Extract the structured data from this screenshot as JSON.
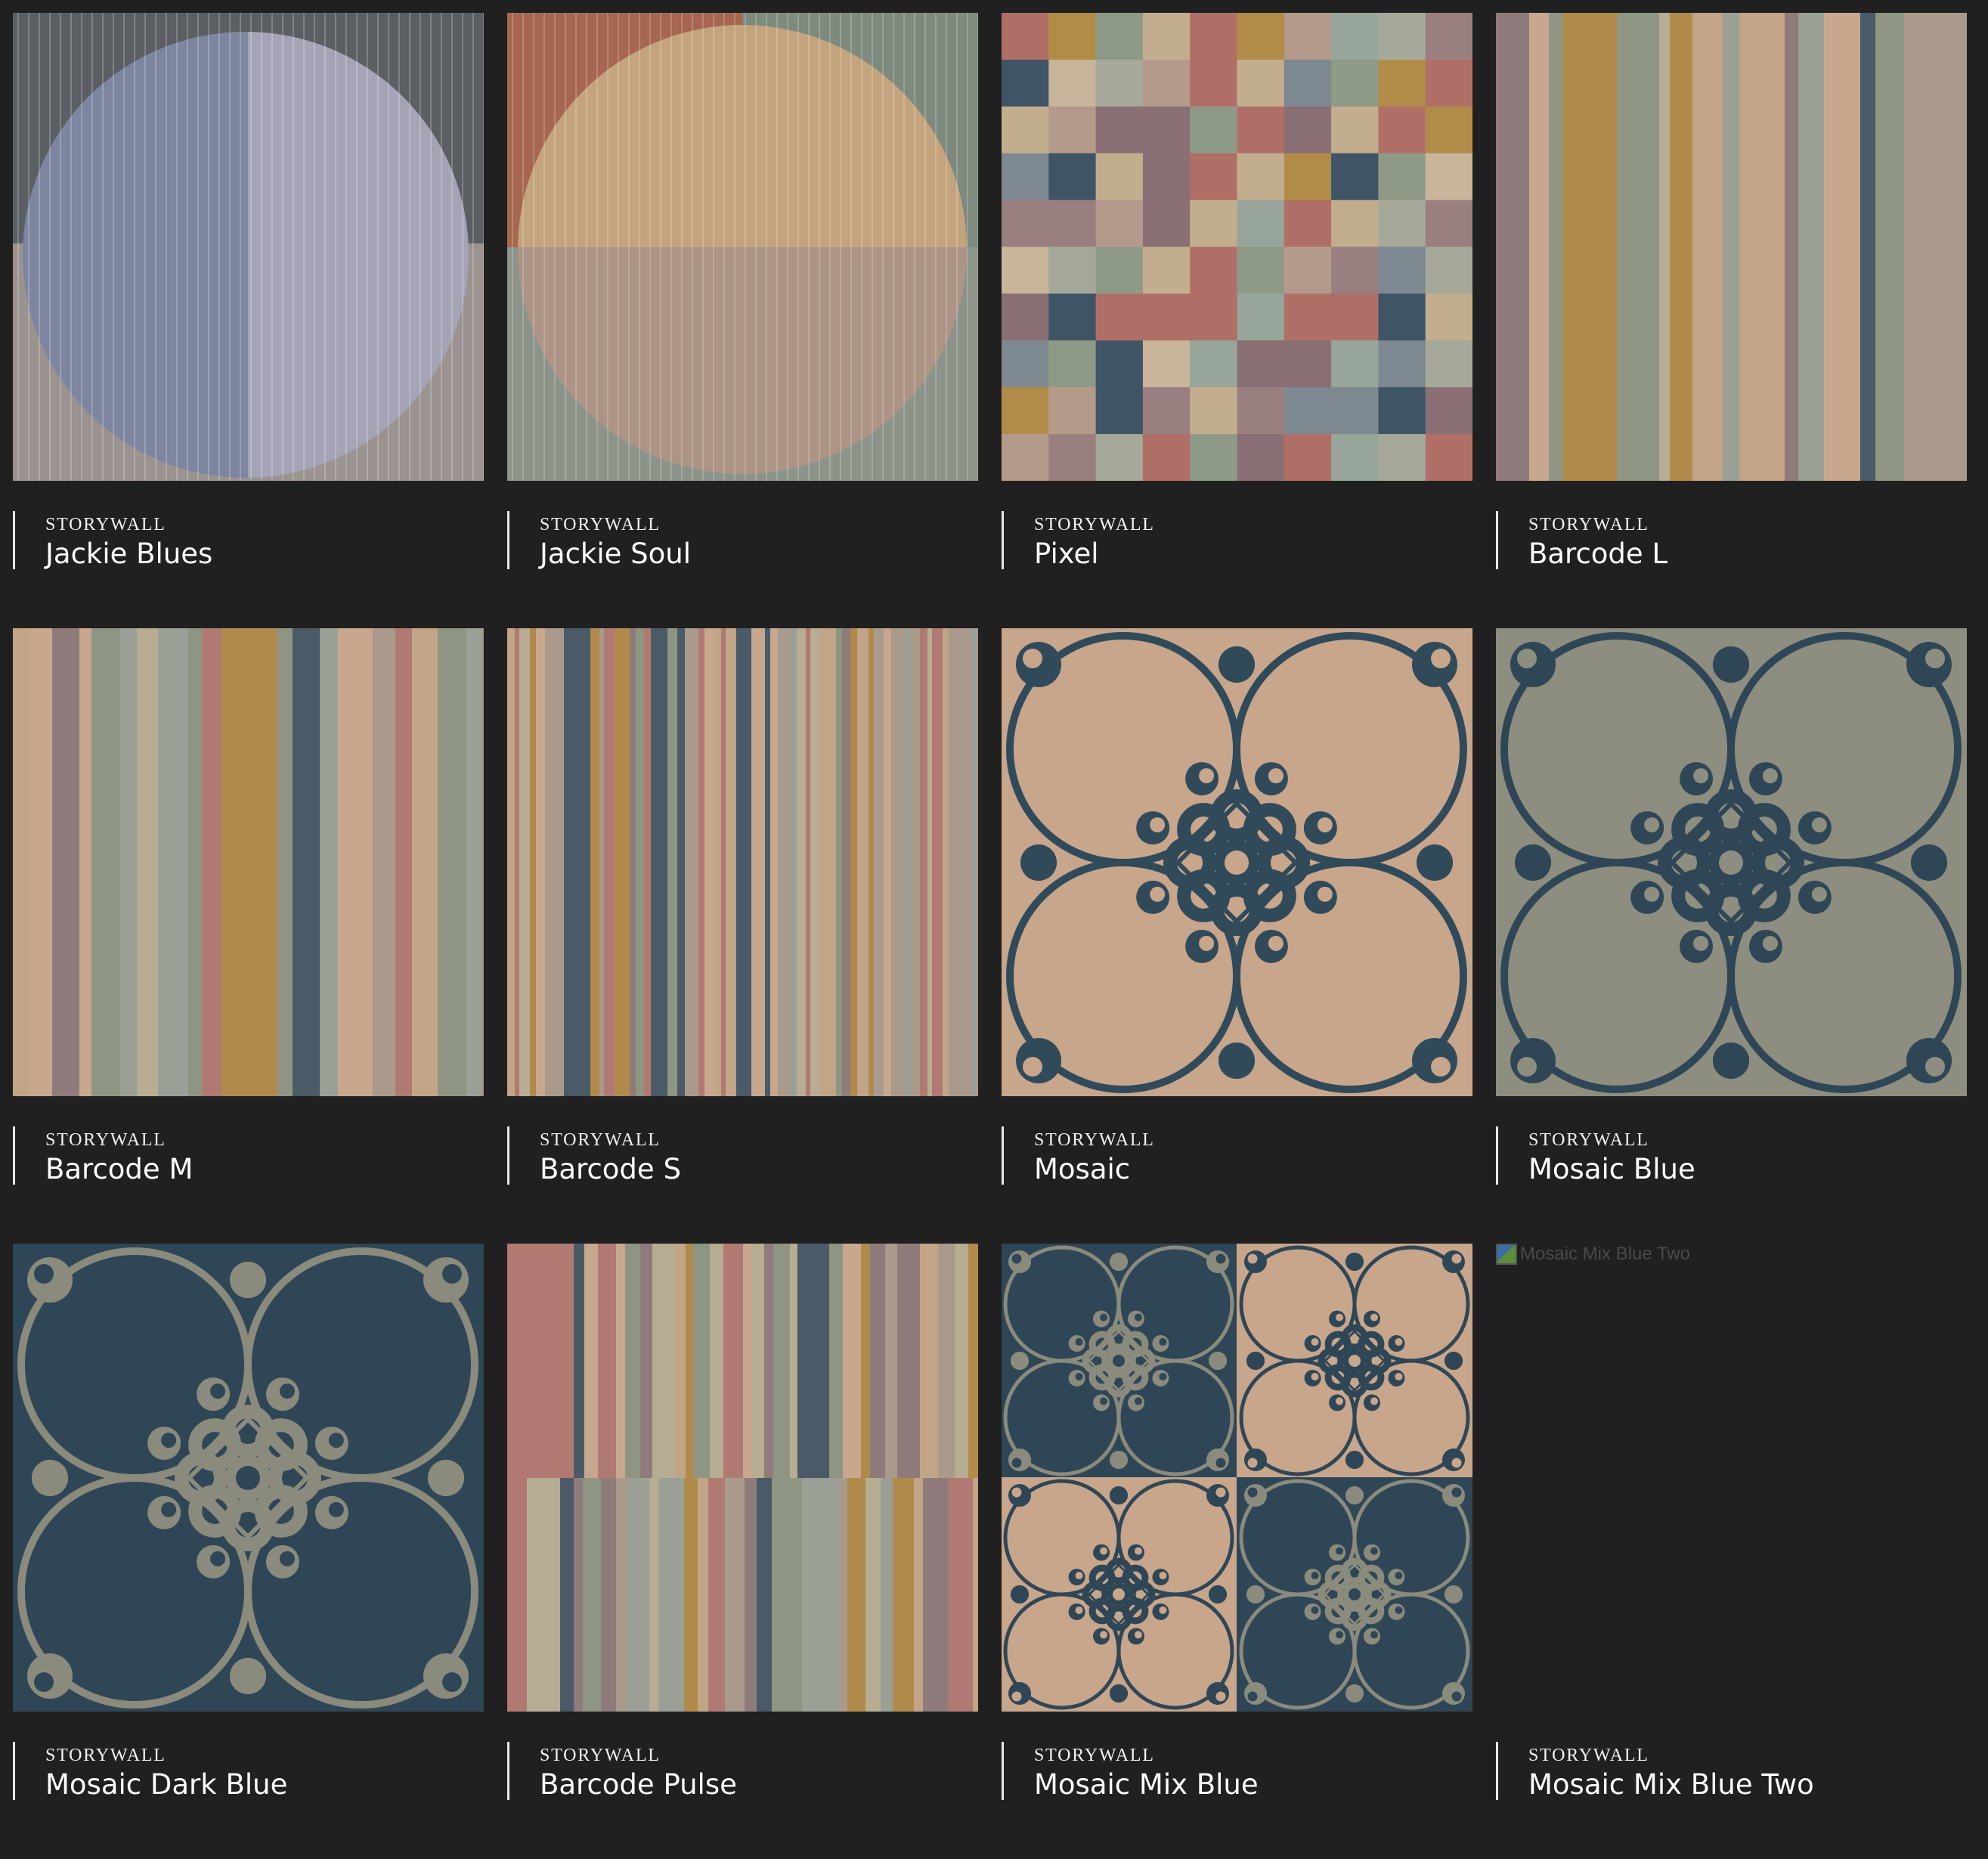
{
  "tiles": [
    {
      "brand": "STORYWALL",
      "name": "Jackie Blues",
      "pattern": "jackie-blues"
    },
    {
      "brand": "STORYWALL",
      "name": "Jackie Soul",
      "pattern": "jackie-soul"
    },
    {
      "brand": "STORYWALL",
      "name": "Pixel",
      "pattern": "pixel"
    },
    {
      "brand": "STORYWALL",
      "name": "Barcode L",
      "pattern": "barcode-l"
    },
    {
      "brand": "STORYWALL",
      "name": "Barcode M",
      "pattern": "barcode-m"
    },
    {
      "brand": "STORYWALL",
      "name": "Barcode S",
      "pattern": "barcode-s"
    },
    {
      "brand": "STORYWALL",
      "name": "Mosaic",
      "pattern": "mosaic"
    },
    {
      "brand": "STORYWALL",
      "name": "Mosaic Blue",
      "pattern": "mosaic-blue"
    },
    {
      "brand": "STORYWALL",
      "name": "Mosaic Dark Blue",
      "pattern": "mosaic-dark-blue"
    },
    {
      "brand": "STORYWALL",
      "name": "Barcode Pulse",
      "pattern": "barcode-pulse"
    },
    {
      "brand": "STORYWALL",
      "name": "Mosaic Mix Blue",
      "pattern": "mosaic-mix-blue"
    },
    {
      "brand": "STORYWALL",
      "name": "Mosaic Mix Blue Two",
      "pattern": "broken-image",
      "alt_text": "Mosaic Mix Blue Two"
    }
  ],
  "colors": {
    "background": "#202020",
    "caption_bar": "#e8e8e8",
    "navy": "#2f4a5c",
    "sand": "#c9a98c",
    "sage": "#8e9582",
    "rose": "#b07a72",
    "ochre": "#b08a4a",
    "mauve": "#8f7b7b",
    "slate": "#5b6166"
  }
}
